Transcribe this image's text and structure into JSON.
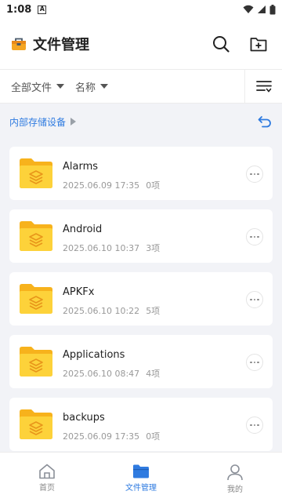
{
  "status_bar": {
    "time": "1:08",
    "notif_glyph": "A"
  },
  "header": {
    "title": "文件管理"
  },
  "filters": {
    "type_label": "全部文件",
    "sort_label": "名称"
  },
  "breadcrumb": {
    "location": "内部存储设备"
  },
  "files": [
    {
      "name": "Alarms",
      "date": "2025.06.09 17:35",
      "count": "0项"
    },
    {
      "name": "Android",
      "date": "2025.06.10 10:37",
      "count": "3项"
    },
    {
      "name": "APKFx",
      "date": "2025.06.10 10:22",
      "count": "5项"
    },
    {
      "name": "Applications",
      "date": "2025.06.10 08:47",
      "count": "4项"
    },
    {
      "name": "backups",
      "date": "2025.06.09 17:35",
      "count": "0项"
    }
  ],
  "bottom_nav": [
    {
      "label": "首页",
      "icon": "home-icon",
      "active": false
    },
    {
      "label": "文件管理",
      "icon": "folder-icon",
      "active": true
    },
    {
      "label": "我的",
      "icon": "person-icon",
      "active": false
    }
  ],
  "colors": {
    "accent": "#2f7be0",
    "folder": "#f7b21c",
    "folder_front": "#fdd23a",
    "background": "#f2f3f7"
  }
}
